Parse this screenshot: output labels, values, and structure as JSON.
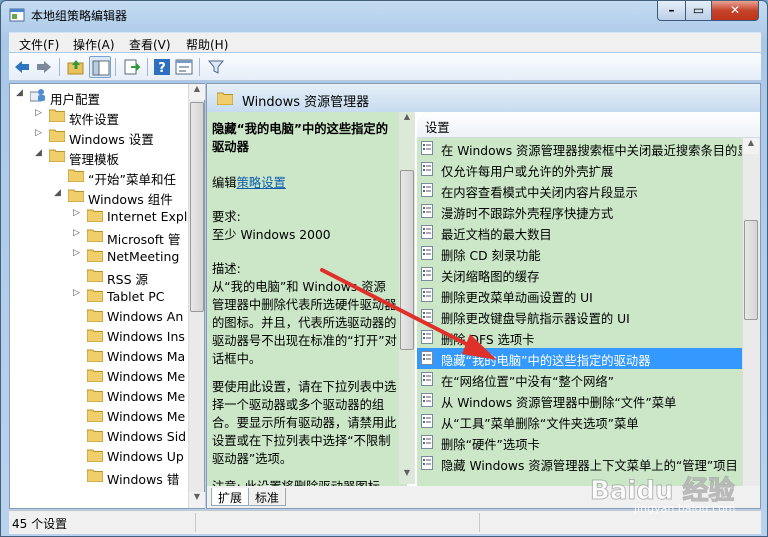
{
  "window": {
    "title": "本地组策略编辑器",
    "min": "–",
    "max": "▭",
    "close": "✕"
  },
  "menu": [
    "文件(F)",
    "操作(A)",
    "查看(V)",
    "帮助(H)"
  ],
  "tree": [
    {
      "label": "用户配置",
      "indent": 0,
      "arrow": "◢",
      "icon": "user-config-icon"
    },
    {
      "label": "软件设置",
      "indent": 1,
      "arrow": "▷",
      "icon": "folder-icon"
    },
    {
      "label": "Windows 设置",
      "indent": 1,
      "arrow": "▷",
      "icon": "folder-icon"
    },
    {
      "label": "管理模板",
      "indent": 1,
      "arrow": "◢",
      "icon": "folder-icon"
    },
    {
      "label": "“开始”菜单和任",
      "indent": 2,
      "arrow": "",
      "icon": "folder-icon"
    },
    {
      "label": "Windows 组件",
      "indent": 2,
      "arrow": "◢",
      "icon": "folder-open-icon"
    },
    {
      "label": "Internet Expl",
      "indent": 3,
      "arrow": "▷",
      "icon": "folder-icon"
    },
    {
      "label": "Microsoft 管",
      "indent": 3,
      "arrow": "▷",
      "icon": "folder-icon"
    },
    {
      "label": "NetMeeting",
      "indent": 3,
      "arrow": "▷",
      "icon": "folder-icon"
    },
    {
      "label": "RSS 源",
      "indent": 3,
      "arrow": "",
      "icon": "folder-icon"
    },
    {
      "label": "Tablet PC",
      "indent": 3,
      "arrow": "▷",
      "icon": "folder-icon"
    },
    {
      "label": "Windows An",
      "indent": 3,
      "arrow": "",
      "icon": "folder-icon"
    },
    {
      "label": "Windows Ins",
      "indent": 3,
      "arrow": "",
      "icon": "folder-icon"
    },
    {
      "label": "Windows Ma",
      "indent": 3,
      "arrow": "",
      "icon": "folder-icon"
    },
    {
      "label": "Windows Me",
      "indent": 3,
      "arrow": "",
      "icon": "folder-icon"
    },
    {
      "label": "Windows Me",
      "indent": 3,
      "arrow": "",
      "icon": "folder-icon"
    },
    {
      "label": "Windows Me",
      "indent": 3,
      "arrow": "",
      "icon": "folder-icon"
    },
    {
      "label": "Windows Sid",
      "indent": 3,
      "arrow": "",
      "icon": "folder-icon"
    },
    {
      "label": "Windows Up",
      "indent": 3,
      "arrow": "",
      "icon": "folder-icon"
    },
    {
      "label": "Windows 错",
      "indent": 3,
      "arrow": "",
      "icon": "folder-icon"
    }
  ],
  "header": {
    "title": "Windows 资源管理器"
  },
  "description": {
    "title": "隐藏“我的电脑”中的这些指定的驱动器",
    "edit_prefix": "编辑",
    "edit_link": "策略设置",
    "requirements_label": "要求:",
    "requirements_value": "至少 Windows 2000",
    "desc_label": "描述:",
    "desc_body": "从“我的电脑”和 Windows 资源管理器中删除代表所选硬件驱动器的图标。并且，代表所选驱动器的驱动器号不出现在标准的“打开”对话框中。",
    "usage": "要使用此设置，请在下拉列表中选择一个驱动器或多个驱动器的组合。要显示所有驱动器，请禁用此设置或在下拉列表中选择“不限制驱动器”选项。",
    "note": "注意: 此设置将删除驱动器图标"
  },
  "list": {
    "column": "设置",
    "items": [
      "在 Windows 资源管理器搜索框中关闭最近搜索条目的显示",
      "仅允许每用户或允许的外壳扩展",
      "在内容查看模式中关闭内容片段显示",
      "漫游时不跟踪外壳程序快捷方式",
      "最近文档的最大数目",
      "删除 CD 刻录功能",
      "关闭缩略图的缓存",
      "删除更改菜单动画设置的 UI",
      "删除更改键盘导航指示器设置的 UI",
      "删除 DFS 选项卡",
      "隐藏“我的电脑”中的这些指定的驱动器",
      "在“网络位置”中没有“整个网络”",
      "从 Windows 资源管理器中删除“文件”菜单",
      "从“工具”菜单删除“文件夹选项”菜单",
      "删除“硬件”选项卡",
      "隐藏 Windows 资源管理器上下文菜单上的“管理”项目"
    ],
    "selected_index": 10
  },
  "tabs": [
    "扩展",
    "标准"
  ],
  "status": {
    "text": "45 个设置"
  },
  "watermark": {
    "text": "Baidu 经验",
    "sub": "jingyan.baidu.com"
  },
  "colors": {
    "selection": "#3399ff",
    "description_bg": "#cbe7c8",
    "arrow": "#e0302a",
    "link": "#0b5cad"
  }
}
